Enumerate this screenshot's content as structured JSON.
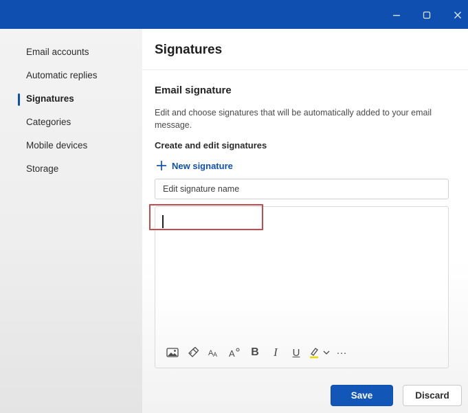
{
  "window": {
    "controls": [
      "minimize-icon",
      "maximize-icon",
      "close-icon"
    ],
    "accent_color": "#0f4fb0"
  },
  "sidebar": {
    "items": [
      {
        "label": "Email accounts",
        "selected": false
      },
      {
        "label": "Automatic replies",
        "selected": false
      },
      {
        "label": "Signatures",
        "selected": true
      },
      {
        "label": "Categories",
        "selected": false
      },
      {
        "label": "Mobile devices",
        "selected": false
      },
      {
        "label": "Storage",
        "selected": false
      }
    ]
  },
  "main": {
    "title": "Signatures",
    "section_title": "Email signature",
    "description": "Edit and choose signatures that will be automatically added to your email message.",
    "subsection_title": "Create and edit signatures",
    "new_signature_label": "New signature",
    "name_input": {
      "value": "",
      "placeholder": "Edit signature name"
    },
    "editor_value": "",
    "highlight_color": "#c64a4a",
    "toolbar": [
      "insert-picture-icon",
      "format-painter-icon",
      "font-size-icon",
      "superscript-icon",
      "bold-icon",
      "italic-icon",
      "underline-icon",
      "highlighter-icon",
      "chevron-down-icon",
      "more-options-icon"
    ],
    "toolbar_glyphs": {
      "bold": "B",
      "italic": "I",
      "underline": "U",
      "more": "···"
    }
  },
  "footer": {
    "save_label": "Save",
    "discard_label": "Discard",
    "save_color": "#1257b8"
  }
}
